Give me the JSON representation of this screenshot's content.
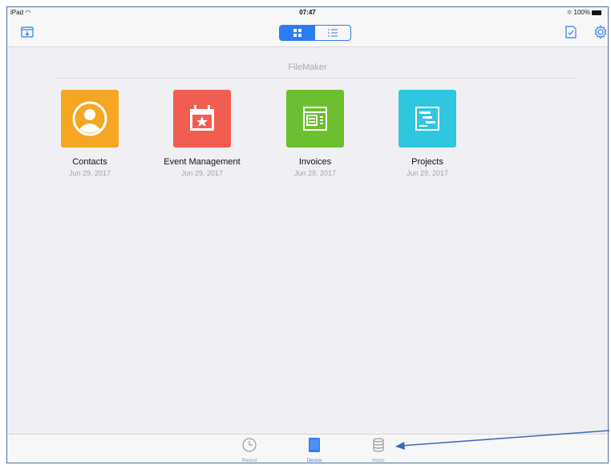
{
  "status_bar": {
    "device": "iPad",
    "time": "07:47",
    "battery": "100%"
  },
  "nav": {
    "view_modes": [
      "grid",
      "list"
    ],
    "selected_view": "grid"
  },
  "section": {
    "title": "FileMaker"
  },
  "files": [
    {
      "name": "Contacts",
      "date": "Jun 29, 2017",
      "icon": "contacts-icon",
      "color": "#f5a623"
    },
    {
      "name": "Event Management",
      "date": "Jun 29, 2017",
      "icon": "calendar-star-icon",
      "color": "#f25d52"
    },
    {
      "name": "Invoices",
      "date": "Jun 29, 2017",
      "icon": "invoice-icon",
      "color": "#6cbf2e"
    },
    {
      "name": "Projects",
      "date": "Jun 29, 2017",
      "icon": "gantt-icon",
      "color": "#2fc6e0"
    }
  ],
  "tabs": [
    {
      "label": "Recent",
      "icon": "clock-icon"
    },
    {
      "label": "Device",
      "icon": "ipad-icon",
      "active": true
    },
    {
      "label": "Hosts",
      "icon": "database-icon"
    }
  ],
  "colors": {
    "accent": "#2f7bf5",
    "annotation_arrow": "#3b6db3"
  }
}
